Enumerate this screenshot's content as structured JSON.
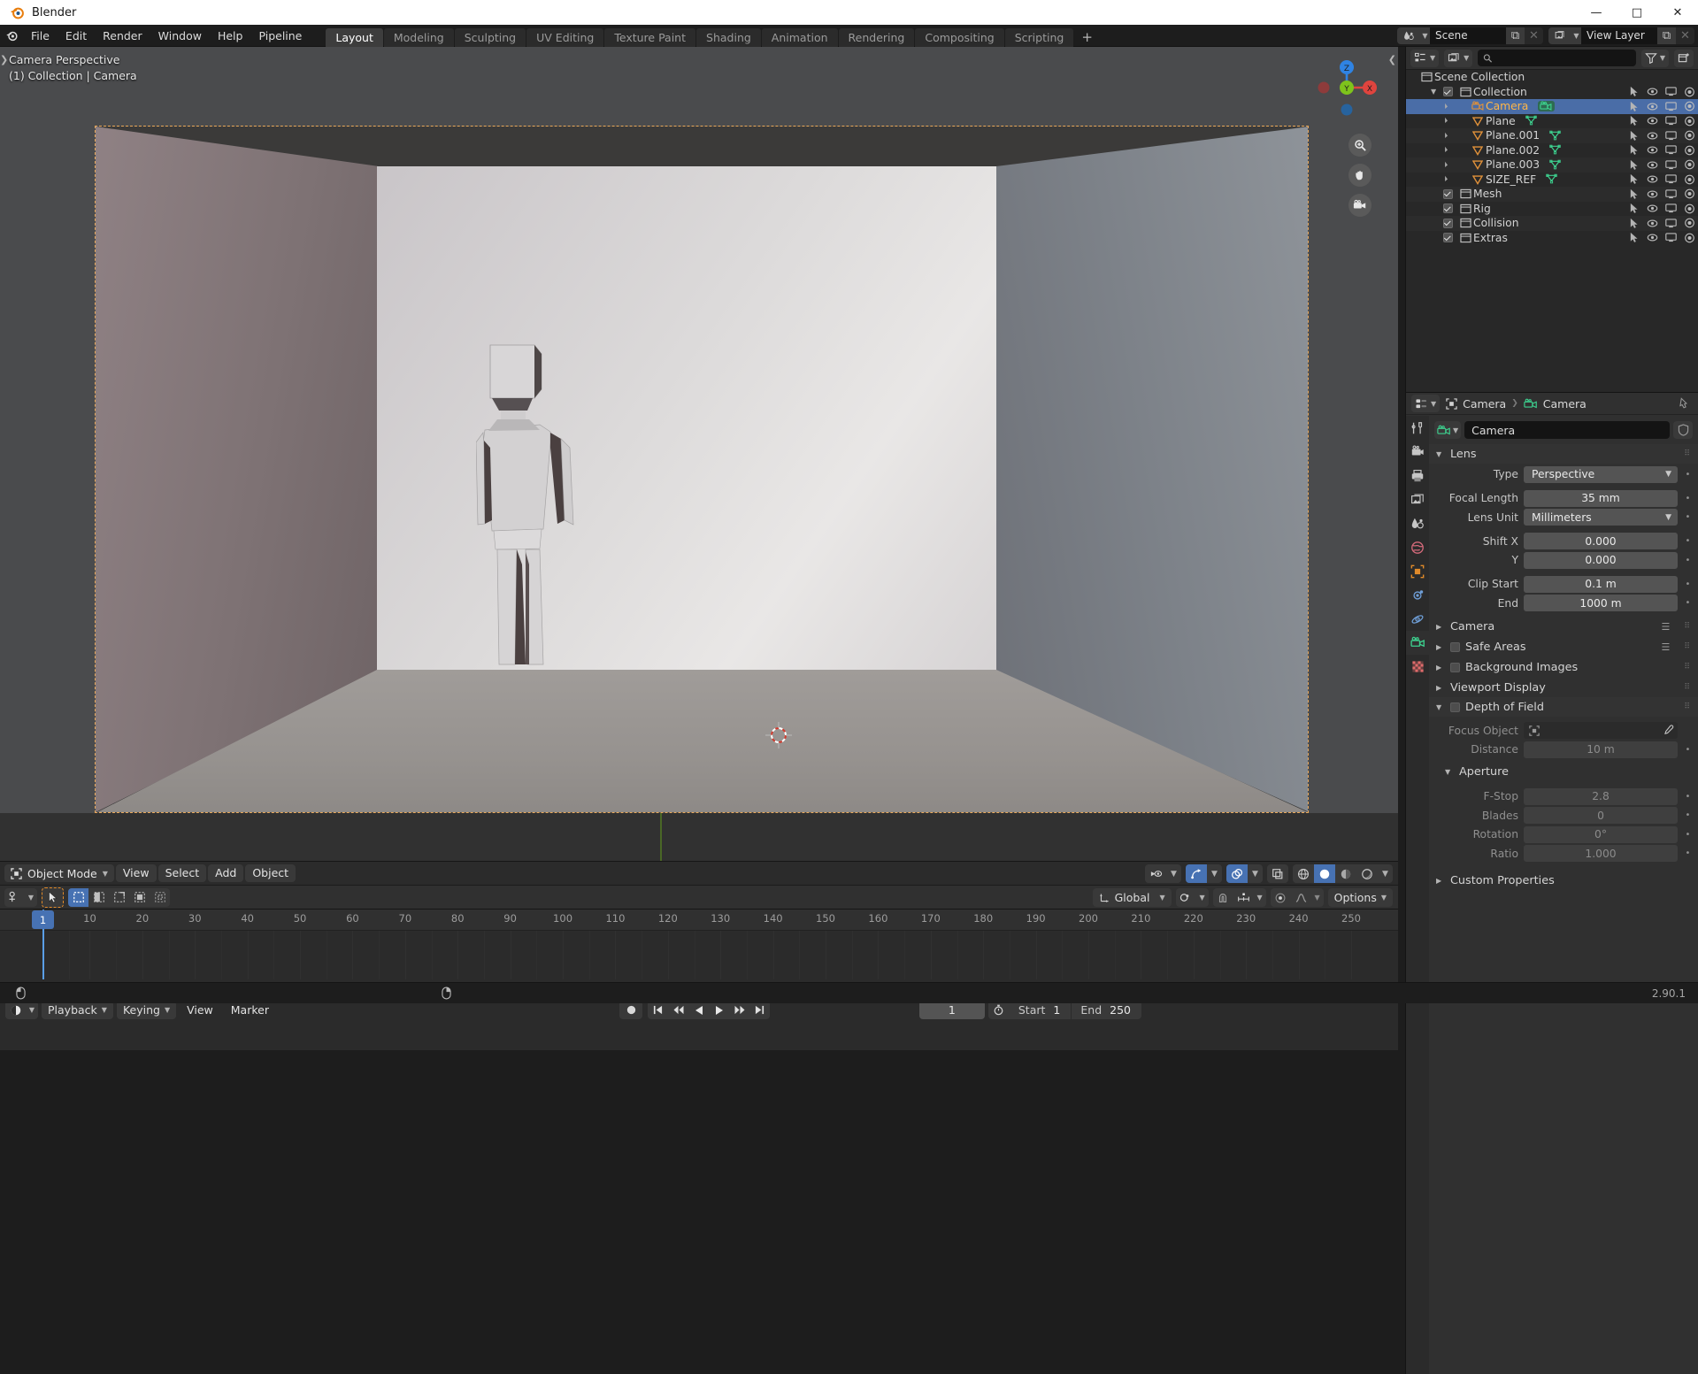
{
  "window": {
    "title": "Blender",
    "minimize": "—",
    "maximize": "□",
    "close": "✕"
  },
  "topbar": {
    "menus": [
      "File",
      "Edit",
      "Render",
      "Window",
      "Help",
      "Pipeline"
    ],
    "tabs": [
      {
        "label": "Layout",
        "active": true
      },
      {
        "label": "Modeling",
        "active": false
      },
      {
        "label": "Sculpting",
        "active": false
      },
      {
        "label": "UV Editing",
        "active": false
      },
      {
        "label": "Texture Paint",
        "active": false
      },
      {
        "label": "Shading",
        "active": false
      },
      {
        "label": "Animation",
        "active": false
      },
      {
        "label": "Rendering",
        "active": false
      },
      {
        "label": "Compositing",
        "active": false
      },
      {
        "label": "Scripting",
        "active": false
      }
    ],
    "add_tab": "+",
    "scene": {
      "name": "Scene",
      "new_label": "⧉",
      "unlink_label": "✕"
    },
    "view_layer": {
      "name": "View Layer",
      "new_label": "⧉",
      "unlink_label": "✕"
    }
  },
  "viewport": {
    "overlay_line1": "Camera Perspective",
    "overlay_line2": "(1) Collection | Camera",
    "gizmo": {
      "x": "X",
      "y": "Y",
      "z": "Z"
    },
    "nav_icons": [
      "zoom-icon",
      "hand-icon",
      "camera-icon"
    ],
    "header": {
      "mode": "Object Mode",
      "menus": [
        "View",
        "Select",
        "Add",
        "Object"
      ],
      "shading_modes": [
        "wireframe",
        "solid",
        "material-preview",
        "rendered"
      ],
      "shading_active": "solid"
    },
    "tool_settings": {
      "transform_orientation": "Global",
      "options_label": "Options"
    }
  },
  "outliner": {
    "search_placeholder": "",
    "root": "Scene Collection",
    "rows": [
      {
        "label": "Collection",
        "indent": 1,
        "type": "collection",
        "checkbox": true,
        "expander": "▼",
        "selected": false
      },
      {
        "label": "Camera",
        "indent": 2,
        "type": "camera",
        "checkbox": false,
        "expander": "▶",
        "selected": true,
        "data_icon": "camera-data"
      },
      {
        "label": "Plane",
        "indent": 2,
        "type": "mesh",
        "checkbox": false,
        "expander": "▶",
        "selected": false,
        "data_icon": "mesh-data"
      },
      {
        "label": "Plane.001",
        "indent": 2,
        "type": "mesh",
        "checkbox": false,
        "expander": "▶",
        "selected": false,
        "data_icon": "mesh-data"
      },
      {
        "label": "Plane.002",
        "indent": 2,
        "type": "mesh",
        "checkbox": false,
        "expander": "▶",
        "selected": false,
        "data_icon": "mesh-data"
      },
      {
        "label": "Plane.003",
        "indent": 2,
        "type": "mesh",
        "checkbox": false,
        "expander": "▶",
        "selected": false,
        "data_icon": "mesh-data"
      },
      {
        "label": "SIZE_REF",
        "indent": 2,
        "type": "mesh",
        "checkbox": false,
        "expander": "▶",
        "selected": false,
        "data_icon": "mesh-data"
      },
      {
        "label": "Mesh",
        "indent": 1,
        "type": "collection",
        "checkbox": true,
        "expander": "",
        "selected": false
      },
      {
        "label": "Rig",
        "indent": 1,
        "type": "collection",
        "checkbox": true,
        "expander": "",
        "selected": false
      },
      {
        "label": "Collision",
        "indent": 1,
        "type": "collection",
        "checkbox": true,
        "expander": "",
        "selected": false
      },
      {
        "label": "Extras",
        "indent": 1,
        "type": "collection",
        "checkbox": true,
        "expander": "",
        "selected": false
      }
    ],
    "row_icons": [
      "cursor-select-icon",
      "eye-icon",
      "monitor-icon",
      "render-camera-icon"
    ]
  },
  "properties": {
    "breadcrumb_object": "Camera",
    "breadcrumb_data": "Camera",
    "id_name": "Camera",
    "tabs": [
      "tool-icon",
      "render-icon",
      "output-icon",
      "view-layer-icon",
      "scene-icon",
      "world-icon",
      "object-icon",
      "modifiers-icon",
      "physics-icon",
      "object-data-camera-icon",
      "texture-icon"
    ],
    "active_tab_index": 9,
    "panels": {
      "lens": {
        "title": "Lens",
        "fields": [
          {
            "label": "Type",
            "value": "Perspective",
            "kind": "dropdown"
          },
          {
            "label": "Focal Length",
            "value": "35 mm",
            "kind": "number"
          },
          {
            "label": "Lens Unit",
            "value": "Millimeters",
            "kind": "dropdown"
          },
          {
            "label": "Shift X",
            "value": "0.000",
            "kind": "number"
          },
          {
            "label": "Y",
            "value": "0.000",
            "kind": "number"
          },
          {
            "label": "Clip Start",
            "value": "0.1 m",
            "kind": "number"
          },
          {
            "label": "End",
            "value": "1000 m",
            "kind": "number"
          }
        ]
      },
      "collapsed": [
        {
          "title": "Camera",
          "checkbox": false,
          "has_list_icon": true
        },
        {
          "title": "Safe Areas",
          "checkbox": true,
          "has_list_icon": true
        },
        {
          "title": "Background Images",
          "checkbox": true,
          "has_list_icon": false
        },
        {
          "title": "Viewport Display",
          "checkbox": false,
          "has_list_icon": false
        }
      ],
      "depth_of_field": {
        "title": "Depth of Field",
        "enabled": false,
        "focus_object_label": "Focus Object",
        "focus_object_value": "",
        "distance_label": "Distance",
        "distance_value": "10 m",
        "aperture_title": "Aperture",
        "aperture_fields": [
          {
            "label": "F-Stop",
            "value": "2.8"
          },
          {
            "label": "Blades",
            "value": "0"
          },
          {
            "label": "Rotation",
            "value": "0°"
          },
          {
            "label": "Ratio",
            "value": "1.000"
          }
        ]
      },
      "custom_properties": {
        "title": "Custom Properties"
      }
    }
  },
  "timeline": {
    "ticks": [
      "1",
      "10",
      "20",
      "30",
      "40",
      "50",
      "60",
      "70",
      "80",
      "90",
      "100",
      "110",
      "120",
      "130",
      "140",
      "150",
      "160",
      "170",
      "180",
      "190",
      "200",
      "210",
      "220",
      "230",
      "240",
      "250"
    ],
    "current_frame_marker": "1",
    "menus": [
      "Playback",
      "Keying",
      "View",
      "Marker"
    ],
    "playback_controls": [
      "jump-start-icon",
      "prev-keyframe-icon",
      "play-reverse-icon",
      "play-icon",
      "next-keyframe-icon",
      "jump-end-icon"
    ],
    "record_icon": "record-icon",
    "current_frame": "1",
    "start_label": "Start",
    "start_value": "1",
    "end_label": "End",
    "end_value": "250"
  },
  "statusbar": {
    "version": "2.90.1"
  },
  "colors": {
    "accent_blue": "#4772b3",
    "select_orange": "#ffb648",
    "camera_frame": "#e9a85a",
    "panel_bg": "#303030",
    "outliner_bg": "#282828"
  }
}
